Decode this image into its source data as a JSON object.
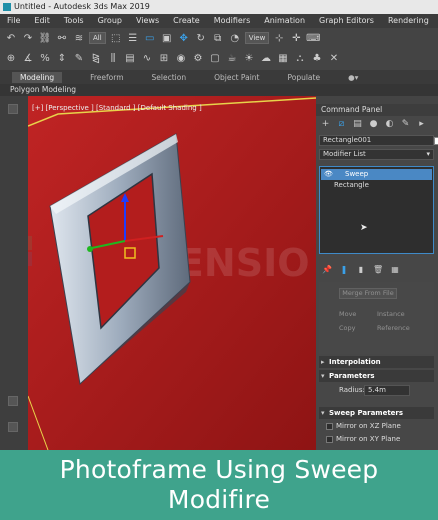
{
  "window": {
    "title": "Untitled - Autodesk 3ds Max 2019"
  },
  "menu": [
    "File",
    "Edit",
    "Tools",
    "Group",
    "Views",
    "Create",
    "Modifiers",
    "Animation",
    "Graph Editors",
    "Rendering",
    "Cu"
  ],
  "toolbar": {
    "filter_value": "All",
    "refcoord_value": "View"
  },
  "ribbon": {
    "tabs": [
      "Modeling",
      "Freeform",
      "Selection",
      "Object Paint",
      "Populate"
    ],
    "active_tab": "Modeling",
    "sub_label": "Polygon Modeling"
  },
  "viewport": {
    "label": "[+] [Perspective ] [Standard ] [Default Shading ]"
  },
  "command_panel": {
    "title": "Command Panel",
    "object_name": "Rectangle001",
    "modifier_list_label": "Modifier List",
    "stack": [
      {
        "label": "Sweep",
        "selected": true
      },
      {
        "label": "Rectangle",
        "selected": false
      }
    ],
    "faded": {
      "merge_label": "Merge From File",
      "move": "Move",
      "copy": "Copy",
      "instance": "Instance",
      "reference": "Reference"
    },
    "rollouts": {
      "interpolation": "Interpolation",
      "parameters": "Parameters",
      "sweep_parameters": "Sweep Parameters"
    },
    "radius": {
      "label": "Radius:",
      "value": "5.4m"
    },
    "checkboxes": [
      "Mirror on XZ Plane",
      "Mirror on XY Plane"
    ]
  },
  "banner": {
    "line1": "Photoframe Using Sweep",
    "line2": "Modifire"
  },
  "colors": {
    "viewport_bg": "#b01c1c",
    "banner": "#3fa38c",
    "selection": "#4a88c4",
    "accent": "#3aa0e8"
  }
}
